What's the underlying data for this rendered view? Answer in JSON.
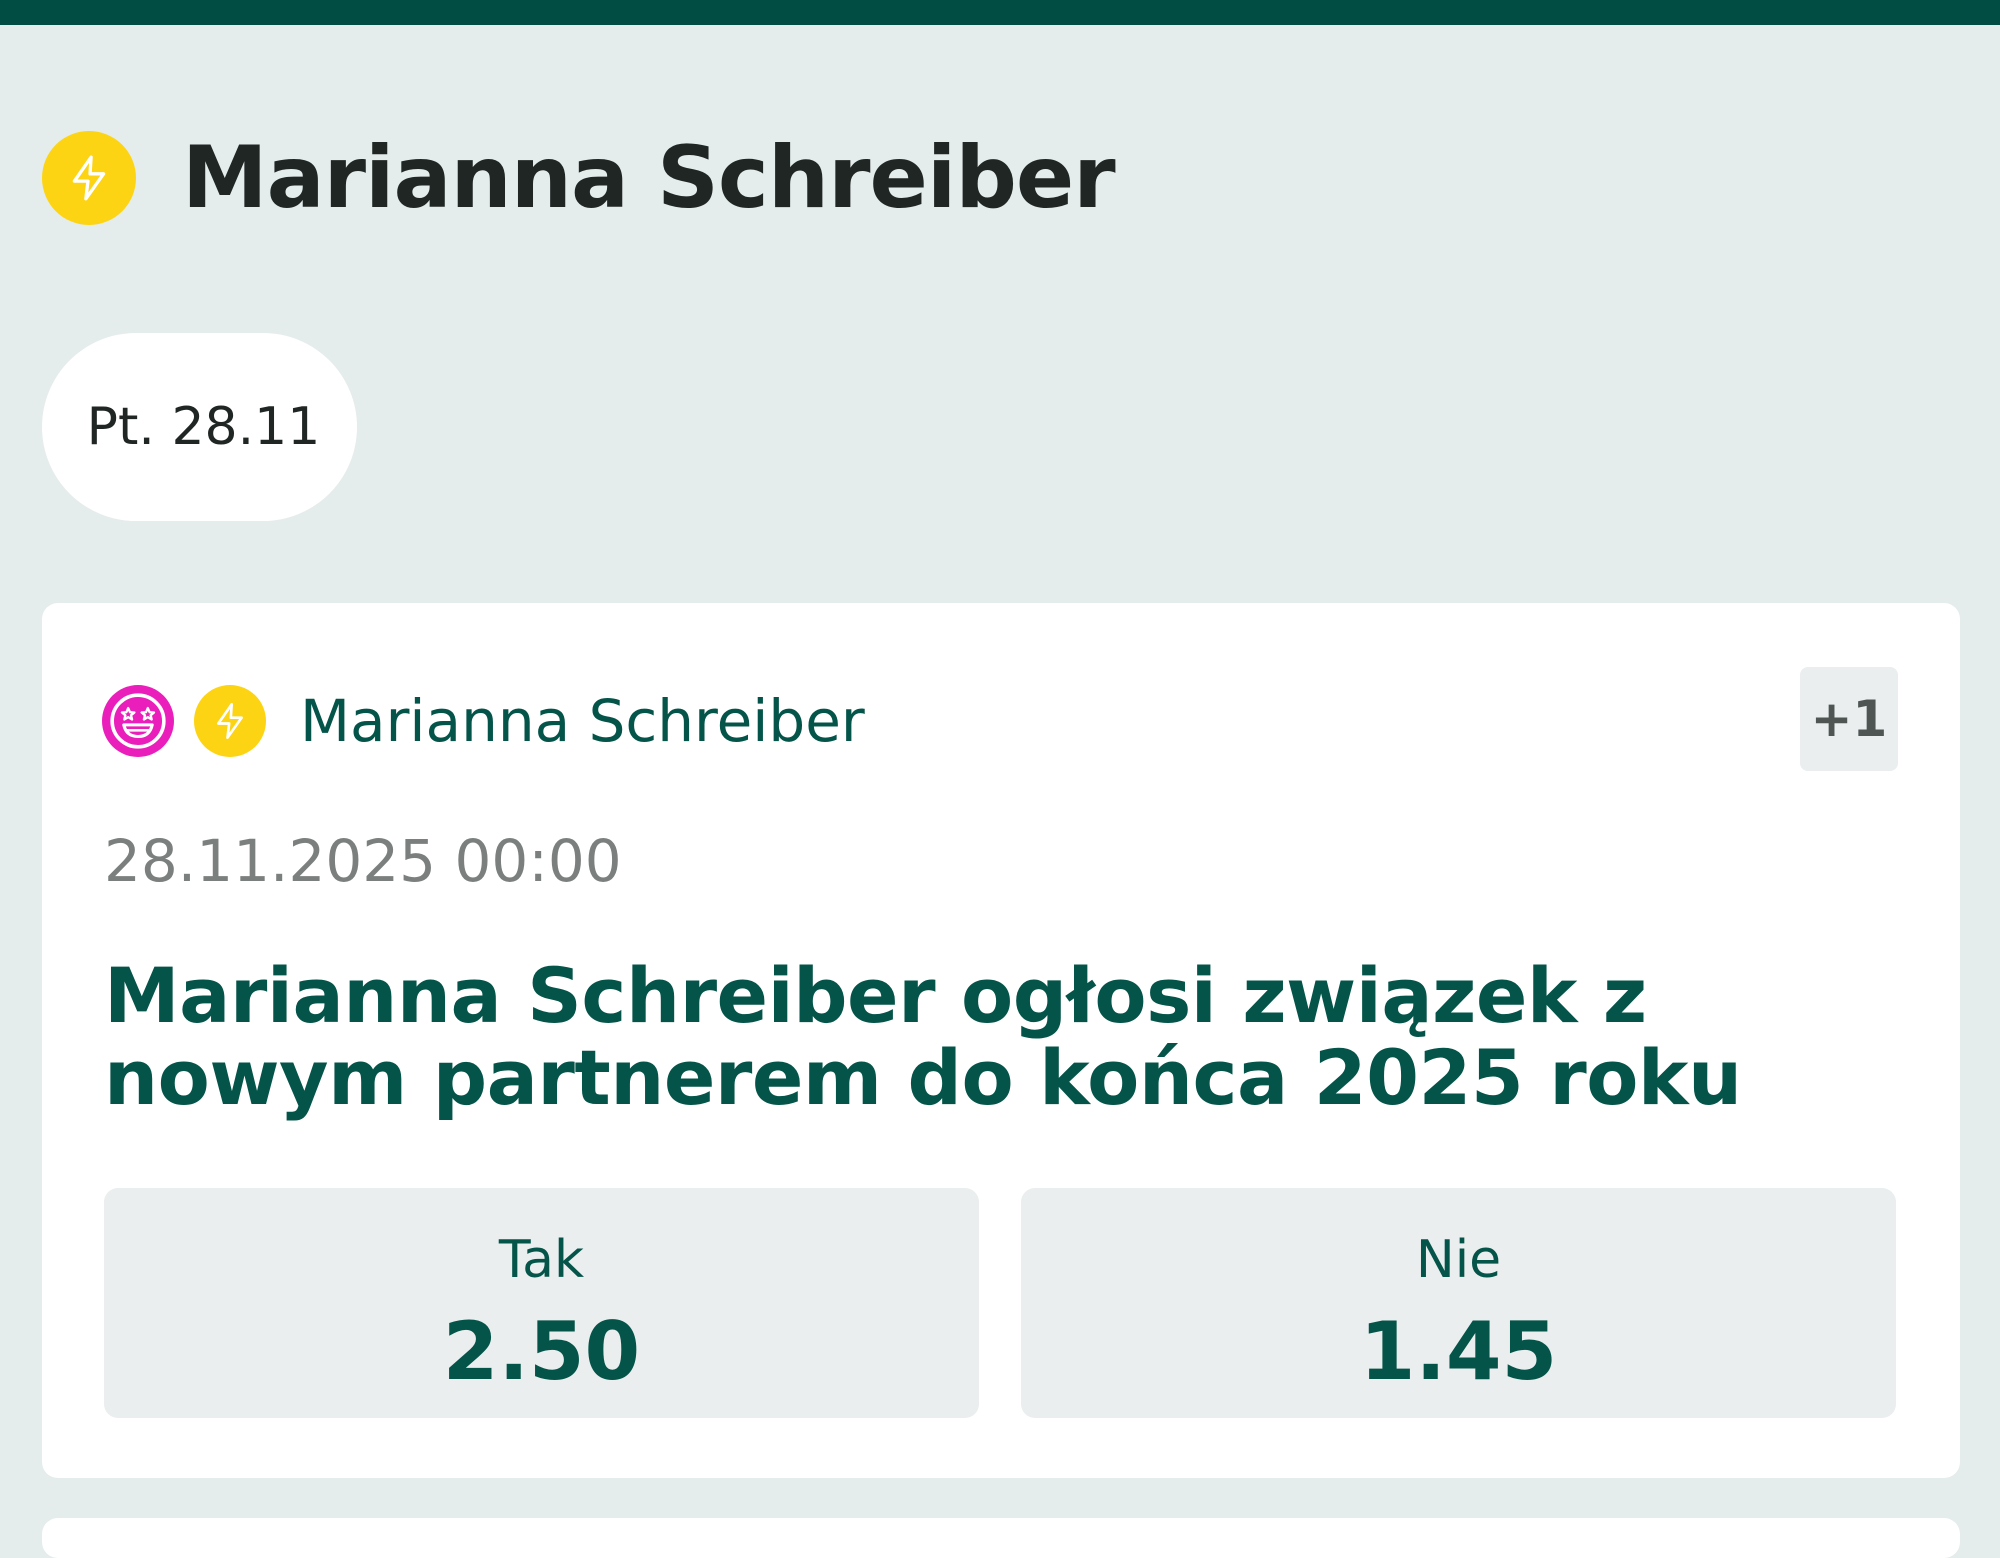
{
  "header": {
    "title": "Marianna Schreiber",
    "icon": "lightning-bolt-icon",
    "icon_color": "#fcd413"
  },
  "date_filter": {
    "label": "Pt. 28.11"
  },
  "event_card": {
    "category_icons": [
      "star-struck-face-icon",
      "lightning-bolt-icon"
    ],
    "category": "Marianna Schreiber",
    "more_badge": "+1",
    "datetime": "28.11.2025 00:00",
    "title": "Marianna Schreiber ogłosi związek z nowym partnerem do końca 2025 roku",
    "options": [
      {
        "label": "Tak",
        "odds": "2.50"
      },
      {
        "label": "Nie",
        "odds": "1.45"
      }
    ]
  },
  "colors": {
    "top_bar": "#014d43",
    "background": "#e5ecec",
    "accent_green": "#045449",
    "bolt_yellow": "#fcd413",
    "emoji_pink": "#ea1fbb"
  }
}
